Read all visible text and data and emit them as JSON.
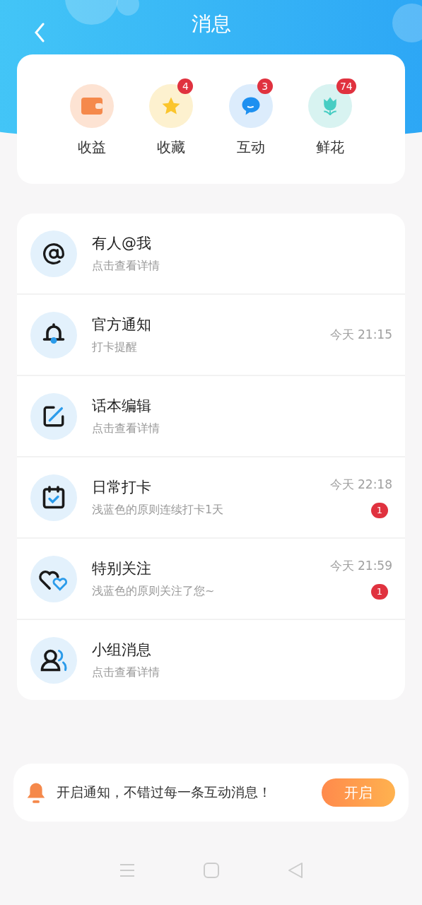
{
  "header": {
    "title": "消息"
  },
  "shortcuts": [
    {
      "kind": "wallet",
      "label": "收益"
    },
    {
      "kind": "star",
      "label": "收藏",
      "badge": "4"
    },
    {
      "kind": "chat",
      "label": "互动",
      "badge": "3"
    },
    {
      "kind": "flower",
      "label": "鲜花",
      "badge": "74"
    }
  ],
  "messages": [
    {
      "kind": "at",
      "title": "有人@我",
      "subtitle": "点击查看详情"
    },
    {
      "kind": "bell",
      "title": "官方通知",
      "subtitle": "打卡提醒",
      "time": "今天 21:15"
    },
    {
      "kind": "edit",
      "title": "话本编辑",
      "subtitle": "点击查看详情"
    },
    {
      "kind": "calendar",
      "title": "日常打卡",
      "subtitle": "浅蓝色的原则连续打卡1天",
      "time": "今天 22:18",
      "badge": "1"
    },
    {
      "kind": "hearts",
      "title": "特别关注",
      "subtitle": "浅蓝色的原则关注了您~",
      "time": "今天 21:59",
      "badge": "1"
    },
    {
      "kind": "group",
      "title": "小组消息",
      "subtitle": "点击查看详情"
    }
  ],
  "notice": {
    "text": "开启通知，不错过每一条互动消息！",
    "button": "开启"
  }
}
